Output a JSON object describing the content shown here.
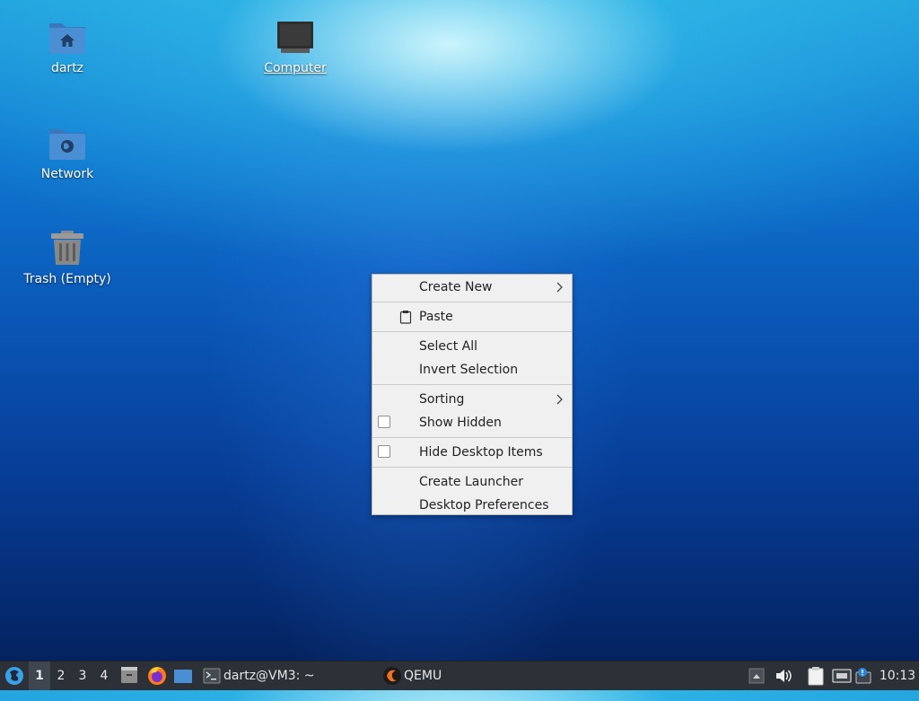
{
  "desktop": {
    "icons": [
      {
        "label": "dartz"
      },
      {
        "label": "Computer"
      },
      {
        "label": "Network"
      },
      {
        "label": "Trash (Empty)"
      }
    ]
  },
  "context_menu": {
    "create_new": "Create New",
    "paste": "Paste",
    "select_all": "Select All",
    "invert_selection": "Invert Selection",
    "sorting": "Sorting",
    "show_hidden": "Show Hidden",
    "show_hidden_checked": false,
    "hide_desktop_items": "Hide Desktop Items",
    "hide_desktop_items_checked": false,
    "create_launcher": "Create Launcher",
    "desktop_preferences": "Desktop Preferences"
  },
  "taskbar": {
    "workspaces": [
      "1",
      "2",
      "3",
      "4"
    ],
    "active_workspace": "1",
    "terminal_window": "dartz@VM3: ~",
    "qemu_window": "QEMU",
    "clock": "10:13"
  },
  "colors": {
    "folder_blue": "#4a8fd4",
    "menu_bg": "#f0f0f0",
    "taskbar_bg": "#2c3138",
    "start_icon": "#3aa0e8"
  },
  "icon_names": [
    "home-folder-icon",
    "computer-icon",
    "network-folder-icon",
    "trash-icon",
    "start-menu-icon",
    "file-manager-icon",
    "firefox-icon",
    "desktop-icon",
    "terminal-icon",
    "qemu-icon",
    "clipboard-icon",
    "volume-icon",
    "network-status-icon",
    "notification-icon"
  ]
}
